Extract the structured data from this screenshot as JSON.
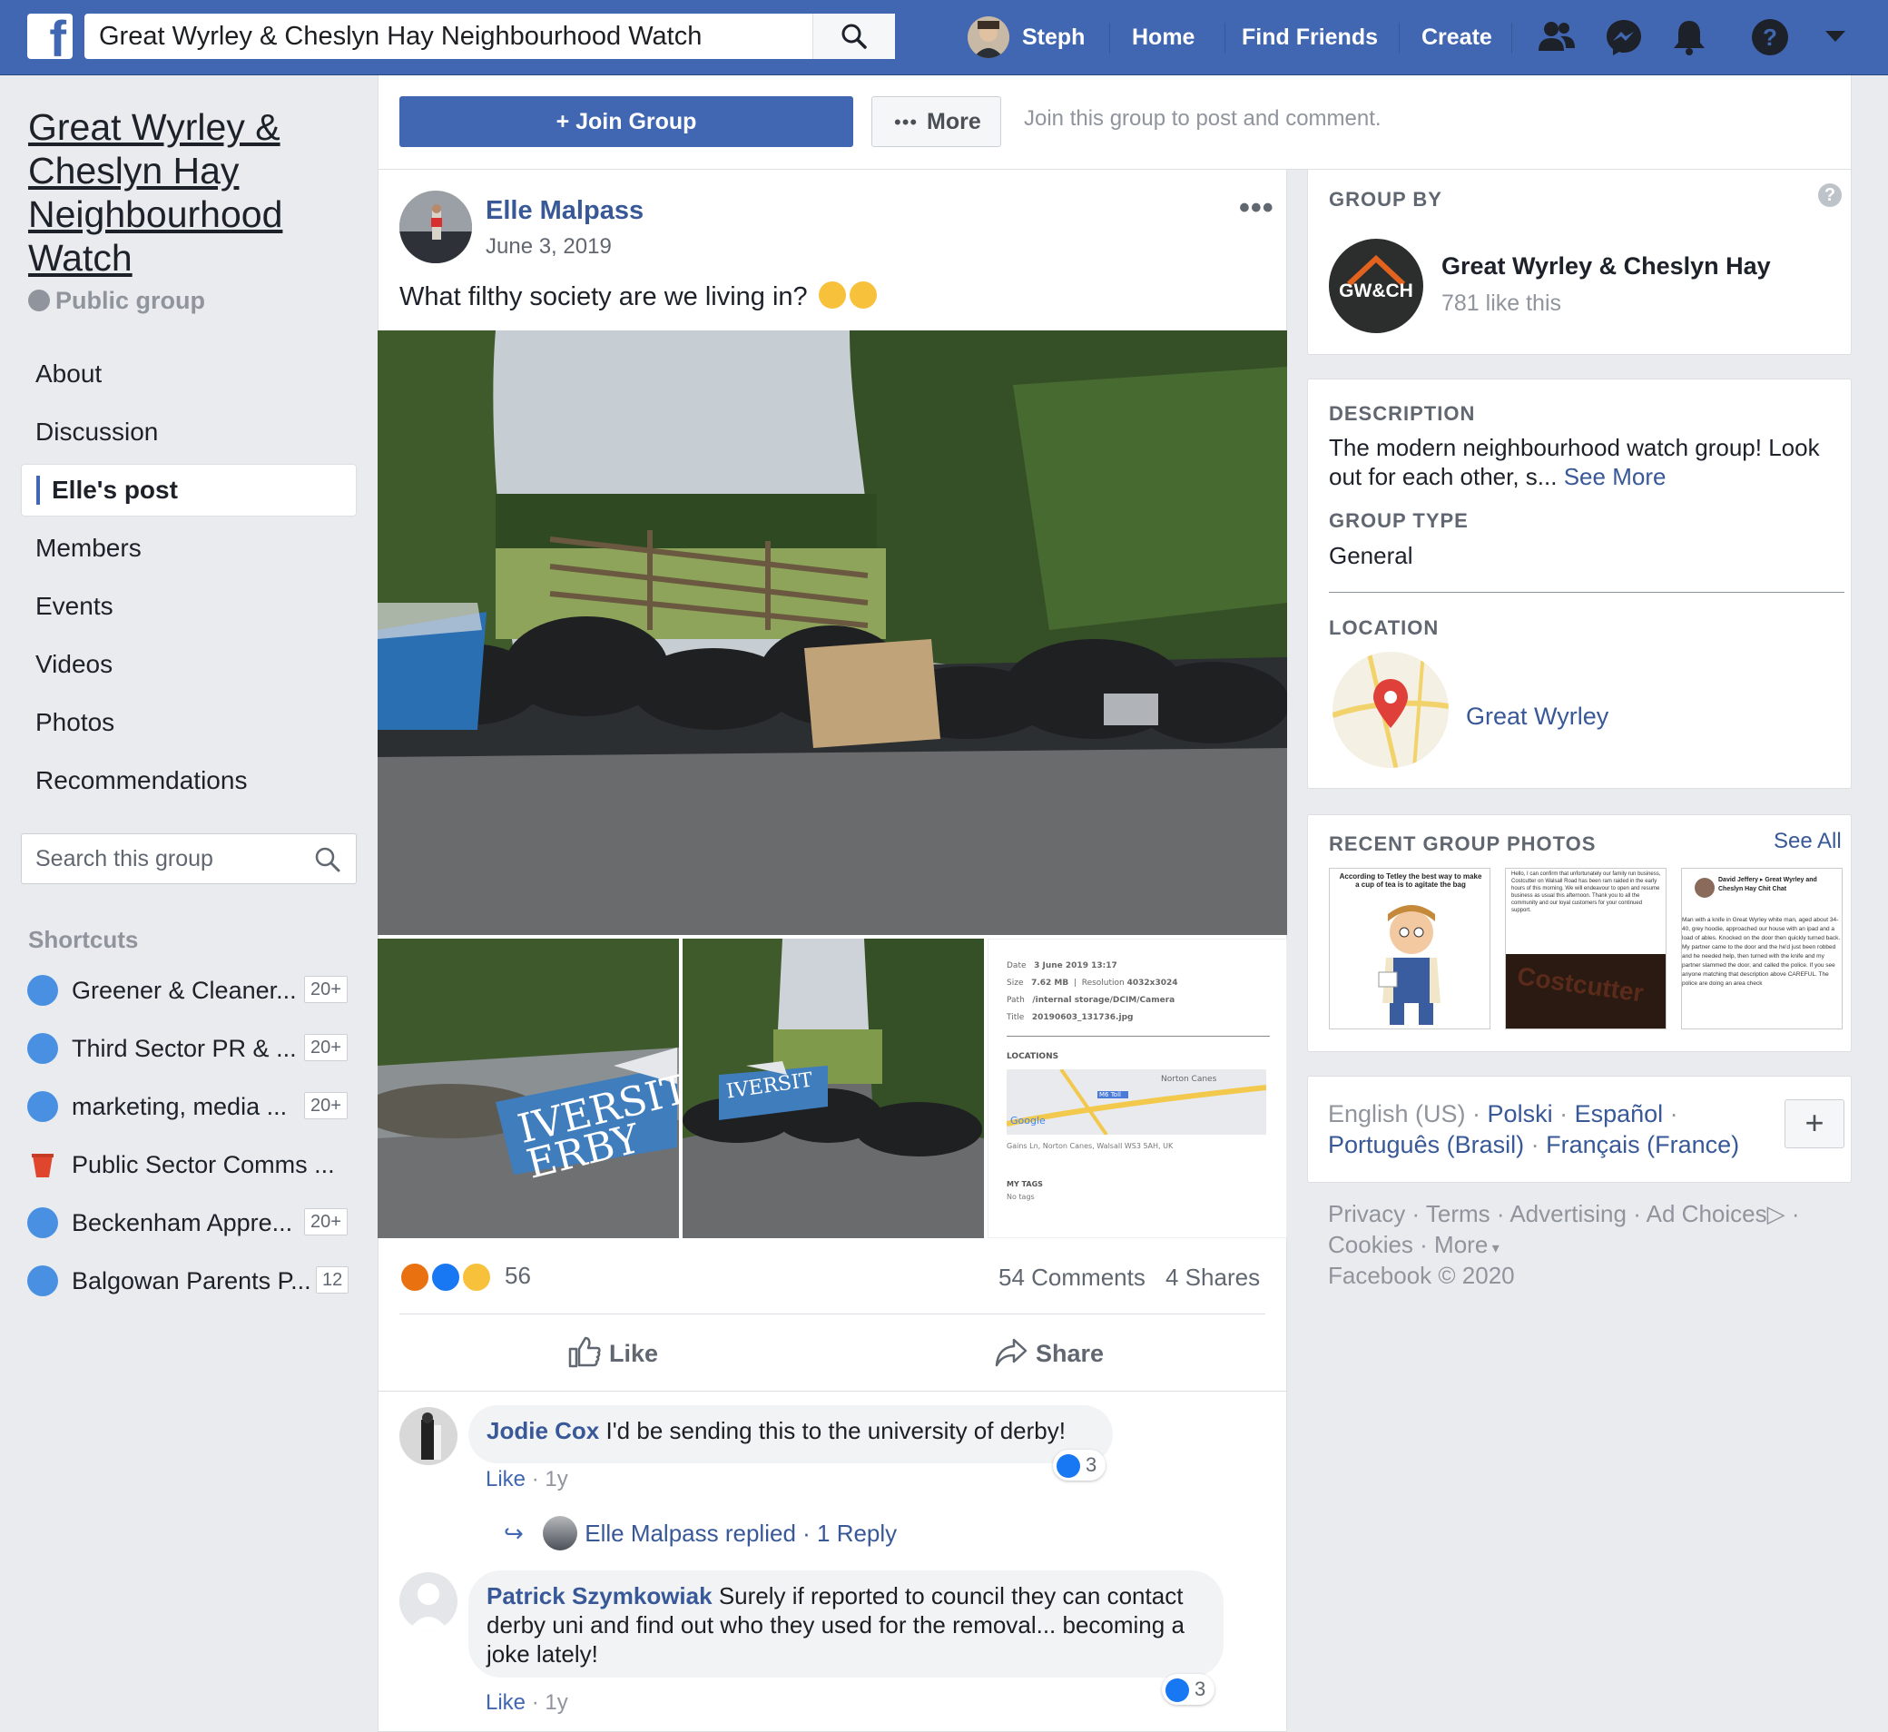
{
  "topbar": {
    "search_value": "Great Wyrley & Cheslyn Hay Neighbourhood Watch",
    "user_name": "Steph",
    "home": "Home",
    "find_friends": "Find Friends",
    "create": "Create",
    "brand_color": "#4267b2"
  },
  "sidebar": {
    "group_title": "Great Wyrley & Cheslyn Hay Neighbourhood Watch",
    "group_privacy": "Public group",
    "nav": [
      {
        "label": "About"
      },
      {
        "label": "Discussion"
      },
      {
        "label": "Elle's post",
        "active": true
      },
      {
        "label": "Members"
      },
      {
        "label": "Events"
      },
      {
        "label": "Videos"
      },
      {
        "label": "Photos"
      },
      {
        "label": "Recommendations"
      }
    ],
    "search_placeholder": "Search this group",
    "shortcuts_title": "Shortcuts",
    "shortcuts": [
      {
        "label": "Greener & Cleaner...",
        "badge": "20+",
        "icon": "group-icon"
      },
      {
        "label": "Third Sector PR & ...",
        "badge": "20+",
        "icon": "group-icon"
      },
      {
        "label": "marketing, media ...",
        "badge": "20+",
        "icon": "group-icon"
      },
      {
        "label": "Public Sector Comms ...",
        "badge": "",
        "icon": "cup-icon"
      },
      {
        "label": "Beckenham Appre...",
        "badge": "20+",
        "icon": "group-icon"
      },
      {
        "label": "Balgowan Parents P...",
        "badge": "12",
        "icon": "group-icon"
      }
    ]
  },
  "joinbar": {
    "join_label": "+ Join Group",
    "more_label": "More",
    "hint": "Join this group to post and comment."
  },
  "post": {
    "author": "Elle Malpass",
    "date": "June 3, 2019",
    "text": "What filthy society are we living in?",
    "reaction_count": "56",
    "comments": "54 Comments",
    "shares": "4 Shares",
    "like_label": "Like",
    "share_label": "Share",
    "photo3": {
      "date_label": "Date",
      "date": "3 June 2019 13:17",
      "size_label": "Size",
      "size": "7.62 MB",
      "res_label": "Resolution",
      "resolution": "4032x3024",
      "path_label": "Path",
      "path": "/internal storage/DCIM/Camera",
      "title_label": "Title",
      "title": "20190603_131736.jpg",
      "locations_label": "LOCATIONS",
      "map_place": "Norton Canes",
      "map_road": "M6 Toll",
      "map_brand": "Google",
      "address": "Gains Ln, Norton Canes, Walsall WS3 5AH, UK",
      "tags_label": "MY TAGS",
      "tags": "No tags"
    },
    "sign_text": "IVERSIT\nERBY",
    "sign_text_small": "IVERSIT"
  },
  "comments": [
    {
      "name": "Jodie Cox",
      "text": "I'd be sending this to the university of derby!",
      "like": "Like",
      "age": "1y",
      "likes": "3"
    },
    {
      "name": "Patrick Szymkowiak",
      "text": "Surely if reported to council they can contact derby uni and find out who they used for the removal... becoming a joke lately!",
      "like": "Like",
      "age": "1y",
      "likes": "3"
    }
  ],
  "reply": {
    "name": "Elle Malpass replied",
    "count": "1 Reply"
  },
  "right": {
    "group_by_title": "GROUP BY",
    "page_name": "Great Wyrley & Cheslyn Hay",
    "page_likes": "781 like this",
    "page_logo_text": "GW&CH",
    "description_title": "DESCRIPTION",
    "description": "The modern neighbourhood watch group! Look out for each other, s...",
    "see_more": "See More",
    "group_type_title": "GROUP TYPE",
    "group_type": "General",
    "location_title": "LOCATION",
    "location": "Great Wyrley",
    "recent_photos_title": "RECENT GROUP PHOTOS",
    "see_all": "See All",
    "recent1_caption": "According to Tetley the best way to make a cup of tea is to agitate the bag",
    "recent2_text": "Hello, I can confirm that unfortunately our family run business, Costcutter on Walsall Road has been ram raided in the early hours of this morning. We will endeavour to open and resume business as usual this afternoon. Thank you to all the community and our loyal customers for your continued support.",
    "recent2_sign": "Costcutter",
    "recent3_header": "David Jeffery ▸ Great Wyrley and Cheslyn Hay Chit Chat",
    "recent3_text": "Man with a knife in Great Wyrley white man, aged about 34-40, grey hoodie, approached our house with an ipad and a load of ables. Knocked on the door then quickly turned back. My partner came to the door and the he'd just been robbed and he needed help, then turned with the knife and my partner slammed the door, and called the police. If you see anyone matching that description above CAREFUL. The police are doing an area check",
    "languages": [
      "English (US)",
      "Polski",
      "Español",
      "Português (Brasil)",
      "Français (France)"
    ],
    "footer_links": [
      "Privacy",
      "Terms",
      "Advertising",
      "Ad Choices",
      "Cookies",
      "More"
    ],
    "copyright": "Facebook © 2020"
  }
}
